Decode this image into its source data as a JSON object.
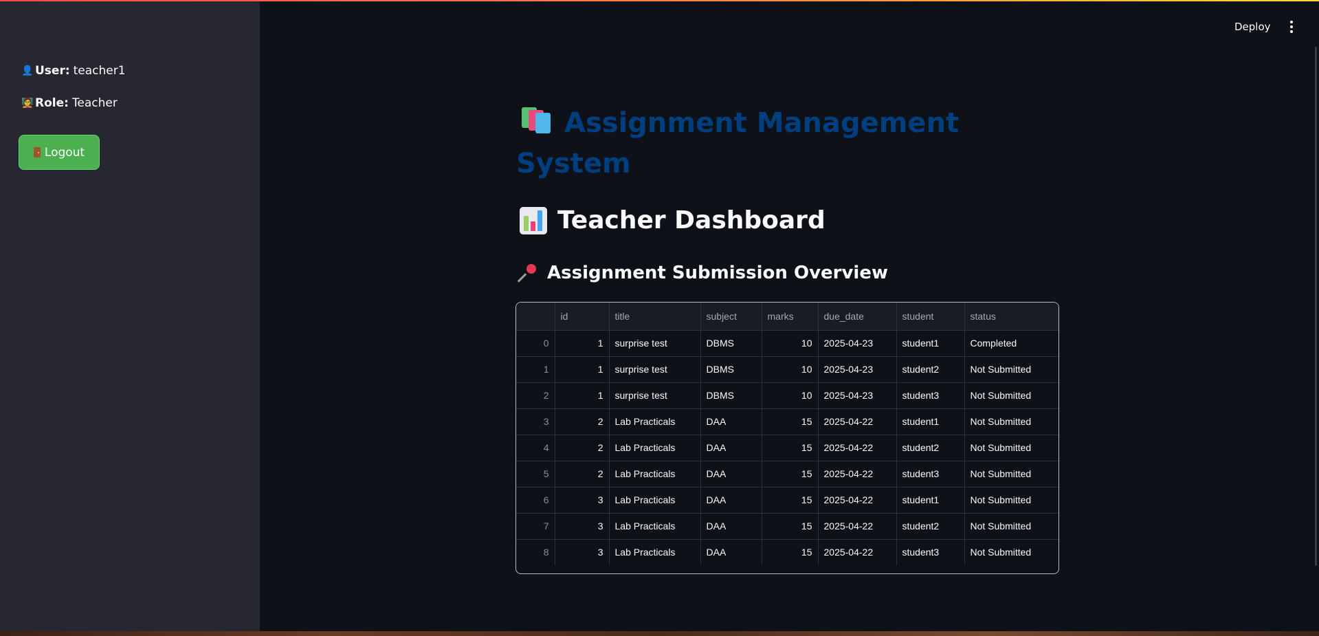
{
  "sidebar": {
    "user_label": "User:",
    "user_value": "teacher1",
    "role_label": "Role:",
    "role_value": "Teacher",
    "logout_label": "Logout"
  },
  "toolbar": {
    "deploy_label": "Deploy"
  },
  "main": {
    "app_title": "Assignment Management System",
    "dashboard_title": "Teacher Dashboard",
    "section_title": "Assignment Submission Overview"
  },
  "table": {
    "columns": [
      "",
      "id",
      "title",
      "subject",
      "marks",
      "due_date",
      "student",
      "status"
    ],
    "rows": [
      [
        "0",
        "1",
        "surprise test",
        "DBMS",
        "10",
        "2025-04-23",
        "student1",
        "Completed"
      ],
      [
        "1",
        "1",
        "surprise test",
        "DBMS",
        "10",
        "2025-04-23",
        "student2",
        "Not Submitted"
      ],
      [
        "2",
        "1",
        "surprise test",
        "DBMS",
        "10",
        "2025-04-23",
        "student3",
        "Not Submitted"
      ],
      [
        "3",
        "2",
        "Lab Practicals",
        "DAA",
        "15",
        "2025-04-22",
        "student1",
        "Not Submitted"
      ],
      [
        "4",
        "2",
        "Lab Practicals",
        "DAA",
        "15",
        "2025-04-22",
        "student2",
        "Not Submitted"
      ],
      [
        "5",
        "2",
        "Lab Practicals",
        "DAA",
        "15",
        "2025-04-22",
        "student3",
        "Not Submitted"
      ],
      [
        "6",
        "3",
        "Lab Practicals",
        "DAA",
        "15",
        "2025-04-22",
        "student1",
        "Not Submitted"
      ],
      [
        "7",
        "3",
        "Lab Practicals",
        "DAA",
        "15",
        "2025-04-22",
        "student2",
        "Not Submitted"
      ],
      [
        "8",
        "3",
        "Lab Practicals",
        "DAA",
        "15",
        "2025-04-22",
        "student3",
        "Not Submitted"
      ]
    ]
  },
  "colors": {
    "background": "#0e1117",
    "sidebar": "#262730",
    "title_blue": "#003f7f",
    "logout_green": "#4caf50"
  },
  "icons": {
    "user": "user-icon",
    "role": "graduation-icon",
    "logout": "door-icon",
    "title": "books-icon",
    "dashboard": "bar-chart-icon",
    "section": "pushpin-icon",
    "menu": "kebab-menu-icon"
  }
}
